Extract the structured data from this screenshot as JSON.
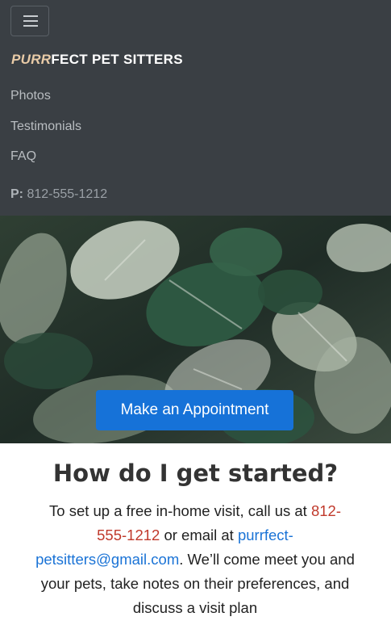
{
  "navbar": {
    "toggle_icon": "hamburger-menu-icon",
    "brand_accent": "PURR",
    "brand_rest": "FECT PET SITTERS",
    "links": [
      "Photos",
      "Testimonials",
      "FAQ"
    ],
    "phone_label": "P:",
    "phone_number": "812-555-1212",
    "background_color": "#3a3f44",
    "brand_accent_color": "#e9cba7"
  },
  "hero": {
    "cta_label": "Make an Appointment",
    "cta_color": "#1672d8"
  },
  "main": {
    "title": "How do I get started?",
    "intro_before_phone": "To set up a free in-home visit, call us at",
    "intro_phone_line1": "812-",
    "intro_phone_line2": "555-1212",
    "intro_middle": " or email at ",
    "intro_email_line1": "purrfect-",
    "intro_email_line2": "petsitters@gmail.com",
    "intro_after": ". We’ll come meet you and your pets, take notes on their preferences, and discuss a visit plan",
    "phone_link_color": "#c0392b",
    "email_link_color": "#1a73d6"
  }
}
